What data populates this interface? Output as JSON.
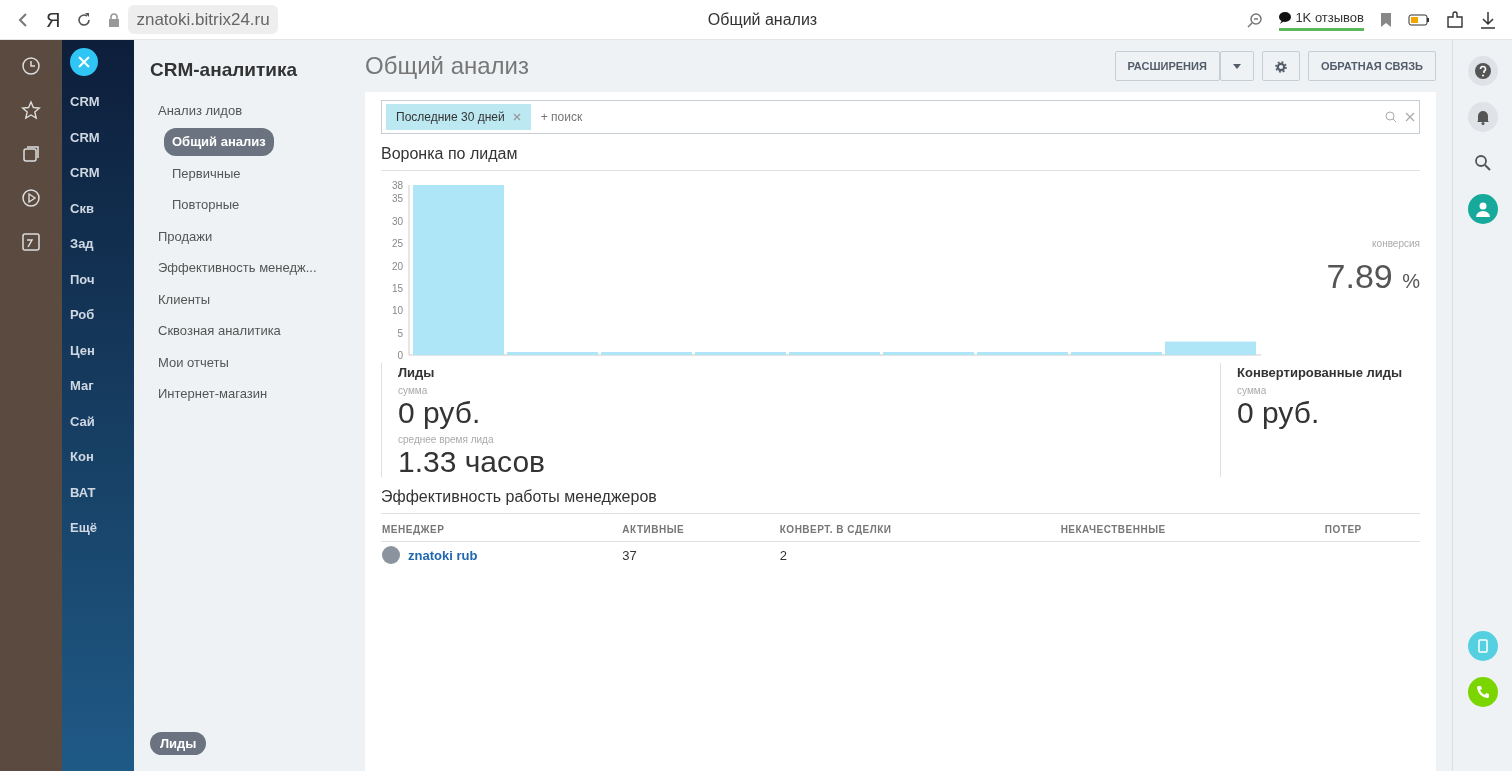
{
  "browser": {
    "letter": "Я",
    "url": "znatoki.bitrix24.ru",
    "caption": "Общий анализ",
    "reviews": "1K отзывов"
  },
  "left_menu": [
    "CRM",
    "CRM",
    "CRM",
    "Скв",
    "Зад",
    "Поч",
    "Роб",
    "Цен",
    "Маг",
    "Сай",
    "Кон",
    "ВАТ",
    "Ещё"
  ],
  "sidebar": {
    "title": "CRM-аналитика",
    "items": [
      {
        "label": "Анализ лидов",
        "selected": false,
        "children": [
          {
            "label": "Общий анализ",
            "selected": true
          },
          {
            "label": "Первичные",
            "selected": false
          },
          {
            "label": "Повторные",
            "selected": false
          }
        ]
      },
      {
        "label": "Продажи",
        "selected": false
      },
      {
        "label": "Эффективность менедж...",
        "selected": false
      },
      {
        "label": "Клиенты",
        "selected": false
      },
      {
        "label": "Сквозная аналитика",
        "selected": false
      },
      {
        "label": "Мои отчеты",
        "selected": false
      },
      {
        "label": "Интернет-магазин",
        "selected": false
      }
    ],
    "bottom_tag": "Лиды"
  },
  "page": {
    "title": "Общий анализ",
    "buttons": [
      "РАСШИРЕНИЯ",
      "ОБРАТНАЯ СВЯЗЬ"
    ],
    "filter": {
      "tag": "Последние 30 дней",
      "placeholder": "+ поиск"
    }
  },
  "funnel": {
    "title": "Воронка по лидам",
    "conversion_label": "конверсия",
    "conversion": "7.89",
    "conversion_unit": "%",
    "chart_data": {
      "type": "bar",
      "categories": [
        null,
        null,
        null,
        null,
        null,
        null,
        null,
        null,
        null
      ],
      "values": [
        38,
        0,
        0,
        0,
        0,
        0,
        0,
        0,
        3
      ],
      "yticks": [
        0,
        5,
        10,
        15,
        20,
        25,
        30,
        35,
        38
      ],
      "ylim": [
        0,
        38
      ]
    },
    "left_stage": {
      "name": "Лиды",
      "sum_label": "сумма",
      "sum": "0 руб.",
      "time_label": "среднее время лида",
      "time": "1.33 часов"
    },
    "right_stage": {
      "name": "Конвертированные лиды",
      "sum_label": "сумма",
      "sum": "0 руб."
    }
  },
  "managers": {
    "title": "Эффективность работы менеджеров",
    "columns": [
      "МЕНЕДЖЕР",
      "АКТИВНЫЕ",
      "КОНВЕРТ. В СДЕЛКИ",
      "НЕКАЧЕСТВЕННЫЕ",
      "ПОТЕР"
    ],
    "rows": [
      [
        "znatoki rub",
        "37",
        "2"
      ]
    ]
  }
}
